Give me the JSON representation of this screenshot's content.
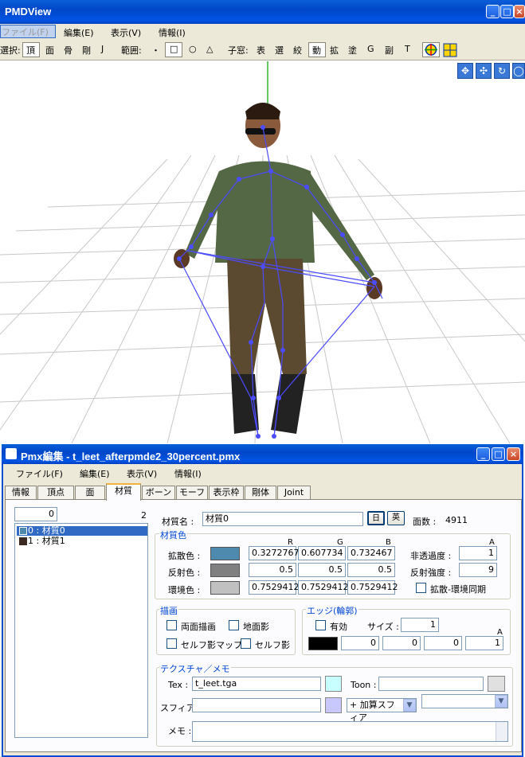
{
  "app": {
    "title": "PMDView",
    "menu": [
      "ファイル(F)",
      "編集(E)",
      "表示(V)",
      "情報(I)"
    ],
    "toolbar": {
      "select_label": "選択:",
      "select_items": [
        "頂",
        "面",
        "骨",
        "剛",
        "J"
      ],
      "range_label": "範囲:",
      "range_items": [
        "・",
        "□",
        "○",
        "△"
      ],
      "child_label": "子窓:",
      "child_items": [
        "表",
        "選",
        "絞",
        "動",
        "拡",
        "塗",
        "G",
        "副",
        "T"
      ]
    }
  },
  "editor": {
    "title": "Pmx編集 - t_leet_afterpmde2_30percent.pmx",
    "menu": [
      "ファイル(F)",
      "編集(E)",
      "表示(V)",
      "情報(I)"
    ],
    "tabs": [
      "情報",
      "頂点",
      "面",
      "材質",
      "ボーン",
      "モーフ",
      "表示枠",
      "剛体",
      "Joint"
    ],
    "active_tab": "材質",
    "index_value": "0",
    "count": "2",
    "materials": [
      {
        "label": "0 : 材質0",
        "color": "#4d8aad"
      },
      {
        "label": "1 : 材質1",
        "color": "#3a2a22"
      }
    ],
    "material_name_label": "材質名 :",
    "material_name": "材質0",
    "lang_ja": "日",
    "lang_en": "英",
    "face_count_label": "面数 :",
    "face_count": "4911",
    "color_group": "材質色",
    "col_r": "R",
    "col_g": "G",
    "col_b": "B",
    "col_a": "A",
    "diffuse_label": "拡散色 :",
    "diffuse_swatch": "#4d8aad",
    "diffuse": [
      "0.3272767",
      "0.607734",
      "0.732467"
    ],
    "specular_label": "反射色 :",
    "specular_swatch": "#808080",
    "specular": [
      "0.5",
      "0.5",
      "0.5"
    ],
    "ambient_label": "環境色 :",
    "ambient_swatch": "#c0c0c0",
    "ambient": [
      "0.7529412",
      "0.7529412",
      "0.7529412"
    ],
    "alpha_label": "非透過度 :",
    "alpha": "1",
    "spec_power_label": "反射強度 :",
    "spec_power": "9",
    "sync_label": "拡散-環境同期",
    "draw_group": "描画",
    "double_sided": "両面描画",
    "ground_shadow": "地面影",
    "self_shadow_map": "セルフ影マップ",
    "self_shadow": "セルフ影",
    "edge_group": "エッジ(輪郭)",
    "edge_enabled": "有効",
    "edge_size_label": "サイズ :",
    "edge_size": "1",
    "edge_color": "#000000",
    "edge_rgba": [
      "0",
      "0",
      "0",
      "1"
    ],
    "texture_group": "テクスチャ／メモ",
    "tex_label": "Tex :",
    "tex_value": "t_leet.tga",
    "tex_color": "#c8ffff",
    "toon_label": "Toon :",
    "toon_value": "",
    "toon_color": "#e0e0e0",
    "sphere_label": "スフィア :",
    "sphere_value": "",
    "sphere_color": "#c8c8ff",
    "sphere_mode": "+ 加算スフィア",
    "memo_label": "メモ :",
    "memo_value": ""
  }
}
